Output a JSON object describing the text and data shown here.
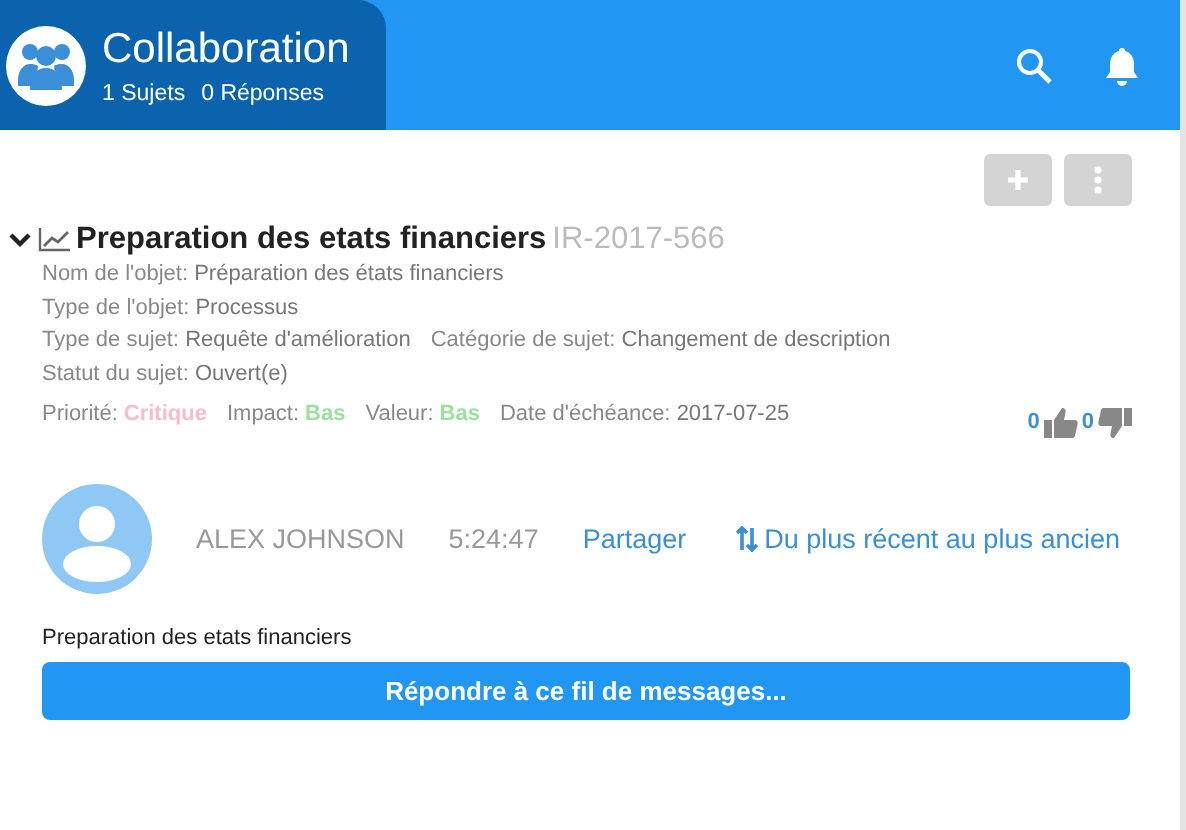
{
  "header": {
    "title": "Collaboration",
    "stats": [
      {
        "count": "1",
        "label": "Sujets"
      },
      {
        "count": "0",
        "label": "Réponses"
      }
    ]
  },
  "topic": {
    "expanded": true,
    "title": "Preparation des etats financiers",
    "id": "IR-2017-566",
    "lines": [
      {
        "fields": [
          {
            "label": "Nom de l'objet:",
            "value": "Préparation des états financiers"
          }
        ]
      },
      {
        "fields": [
          {
            "label": "Type de l'objet:",
            "value": "Processus"
          }
        ]
      },
      {
        "fields": [
          {
            "label": "Type de sujet:",
            "value": "Requête d'amélioration"
          },
          {
            "label": "Catégorie de sujet:",
            "value": "Changement de description"
          }
        ]
      },
      {
        "fields": [
          {
            "label": "Statut du sujet:",
            "value": "Ouvert(e)"
          }
        ]
      }
    ],
    "ratings": [
      {
        "label": "Priorité:",
        "value": "Critique",
        "color": "#f8bbd0"
      },
      {
        "label": "Impact:",
        "value": "Bas",
        "color": "#9be0a0"
      },
      {
        "label": "Valeur:",
        "value": "Bas",
        "color": "#9be0a0"
      }
    ],
    "due": {
      "label": "Date d'échéance:",
      "value": "2017-07-25"
    },
    "likes": "0",
    "dislikes": "0"
  },
  "message": {
    "author": "ALEX JOHNSON",
    "time": "5:24:47",
    "share": "Partager",
    "sort": "Du plus récent au plus ancien",
    "body": "Preparation des etats financiers"
  },
  "reply_button": "Répondre à ce fil de messages..."
}
